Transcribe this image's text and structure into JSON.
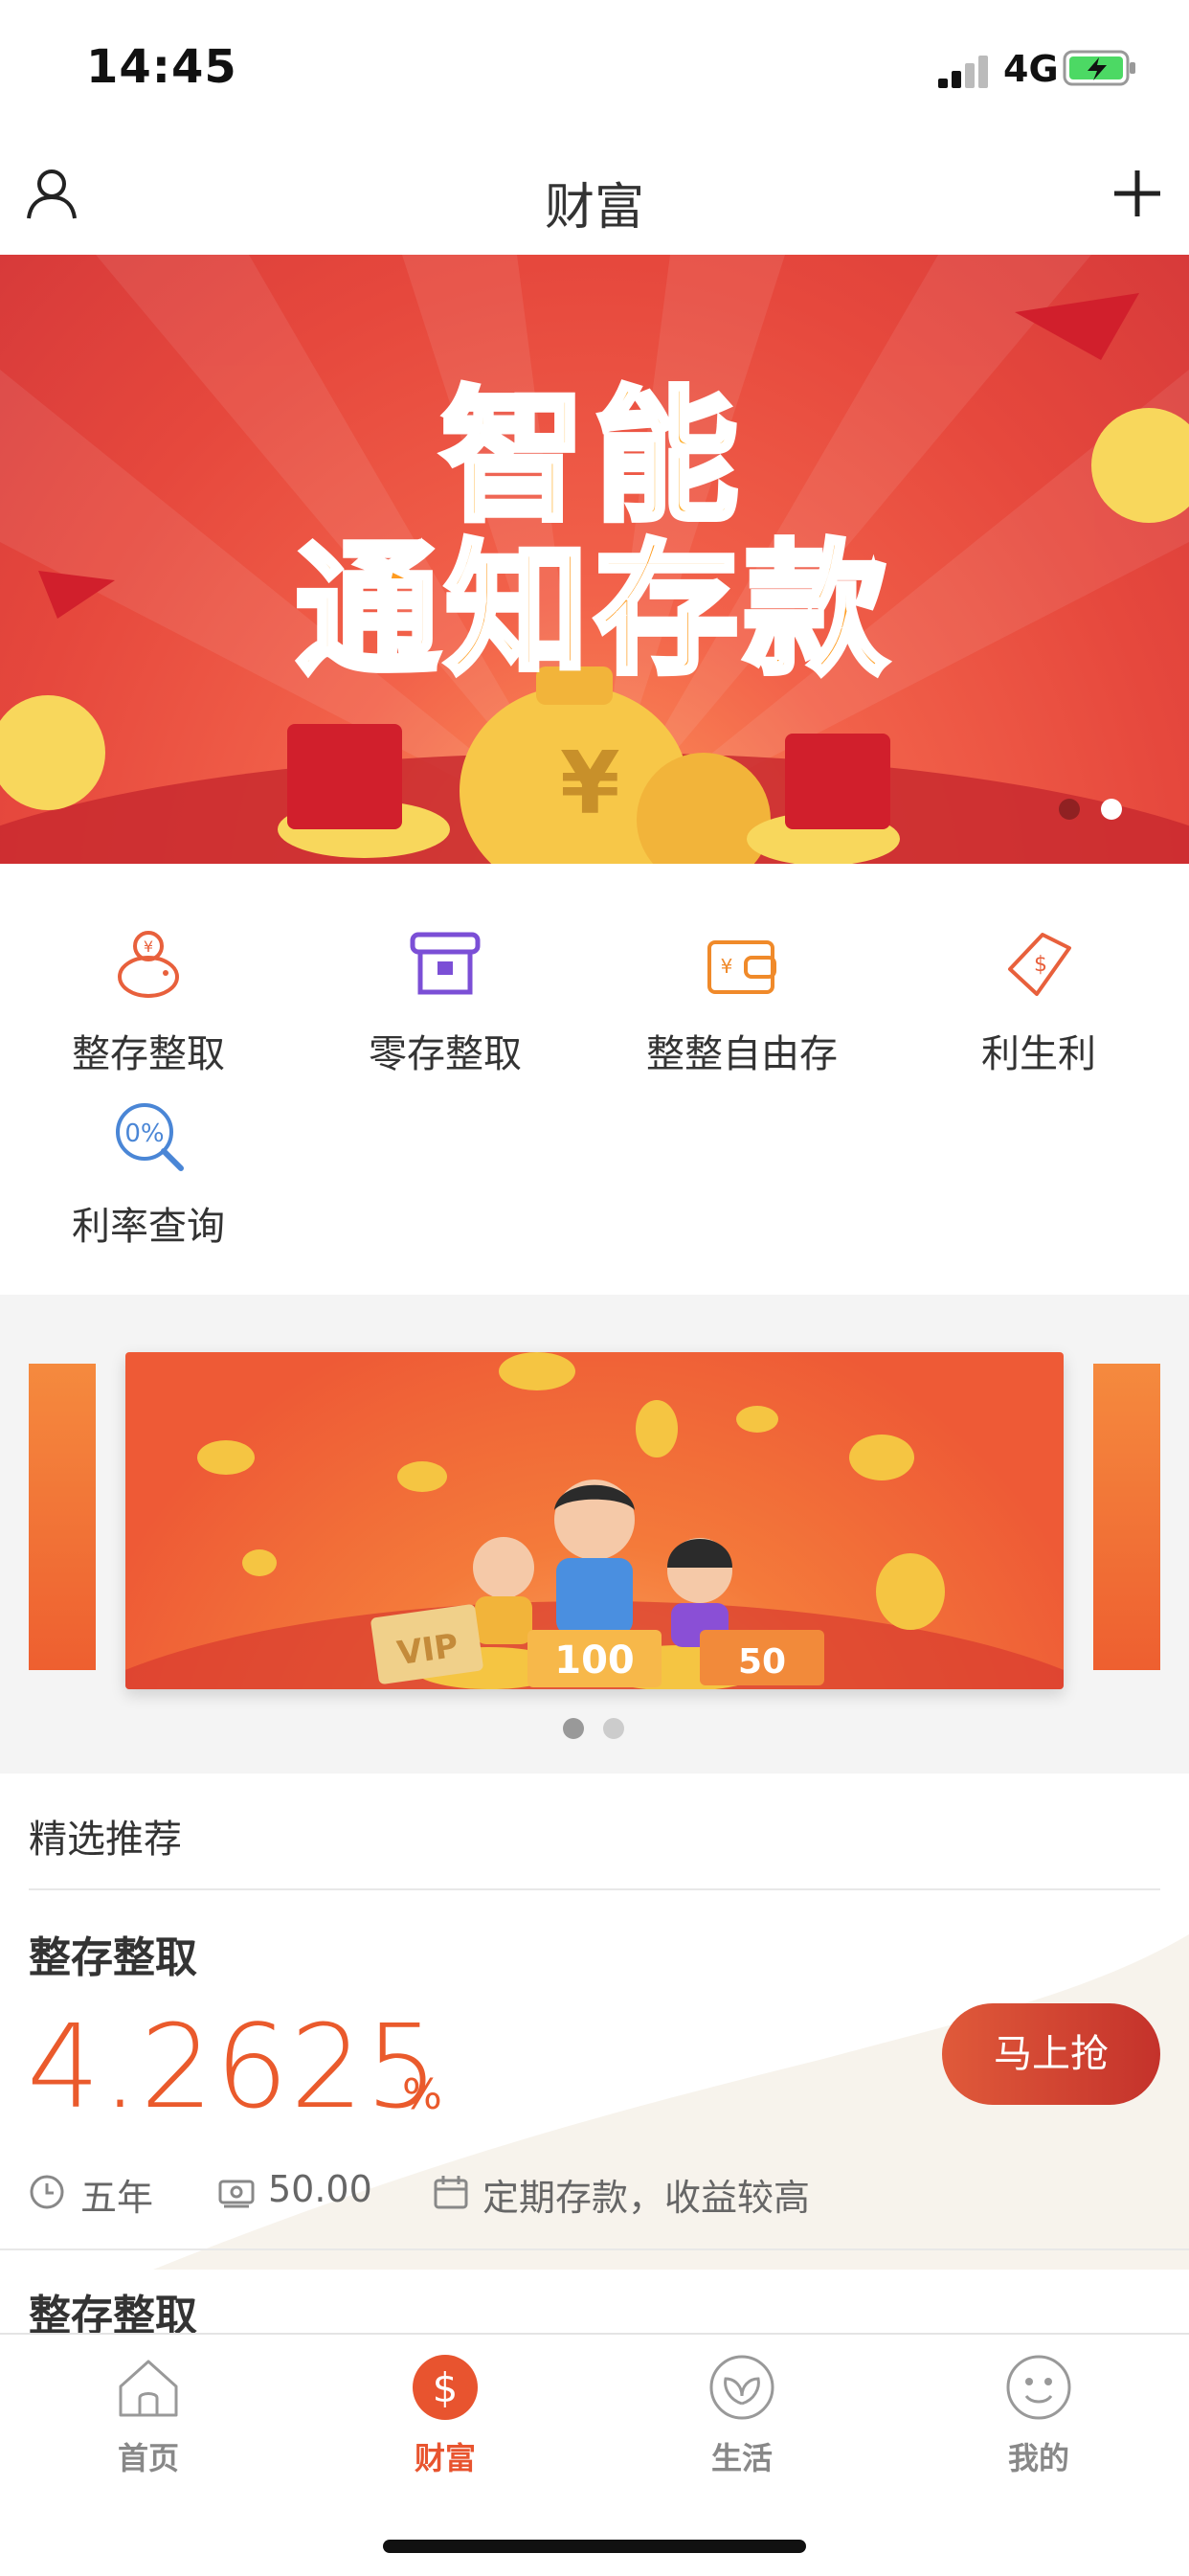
{
  "status_bar": {
    "time": "14:45",
    "network": "4G"
  },
  "nav": {
    "title": "财富"
  },
  "banner": {
    "line1": "智能",
    "line2": "通知存款",
    "currency_symbol": "¥",
    "active_dot": 1
  },
  "quick_actions": [
    {
      "label": "整存整取",
      "icon": "piggy-bank-icon"
    },
    {
      "label": "零存整取",
      "icon": "atm-icon"
    },
    {
      "label": "整整自由存",
      "icon": "wallet-icon"
    },
    {
      "label": "利生利",
      "icon": "money-tag-icon"
    },
    {
      "label": "利率查询",
      "icon": "rate-search-icon"
    }
  ],
  "carousel": {
    "labels": [
      "VIP",
      "100",
      "50"
    ],
    "active_dot": 0
  },
  "recommended": {
    "title": "精选推荐",
    "products": [
      {
        "name": "整存整取",
        "rate": "4.2625",
        "rate_unit": "%",
        "button": "马上抢",
        "term": "五年",
        "min_amount": "50.00",
        "desc": "定期存款，收益较高"
      },
      {
        "name": "整存整取"
      }
    ]
  },
  "tabbar": {
    "items": [
      {
        "label": "首页",
        "icon": "home-icon"
      },
      {
        "label": "财富",
        "icon": "wealth-icon",
        "active": true
      },
      {
        "label": "生活",
        "icon": "leaf-icon"
      },
      {
        "label": "我的",
        "icon": "smile-icon"
      }
    ]
  },
  "colors": {
    "accent": "#ea5a2c",
    "active_tab": "#e8542f",
    "icon_red": "#e8603c",
    "icon_purple": "#7b4fd6",
    "icon_orange": "#f08a2a",
    "icon_blue": "#4a86d6"
  }
}
